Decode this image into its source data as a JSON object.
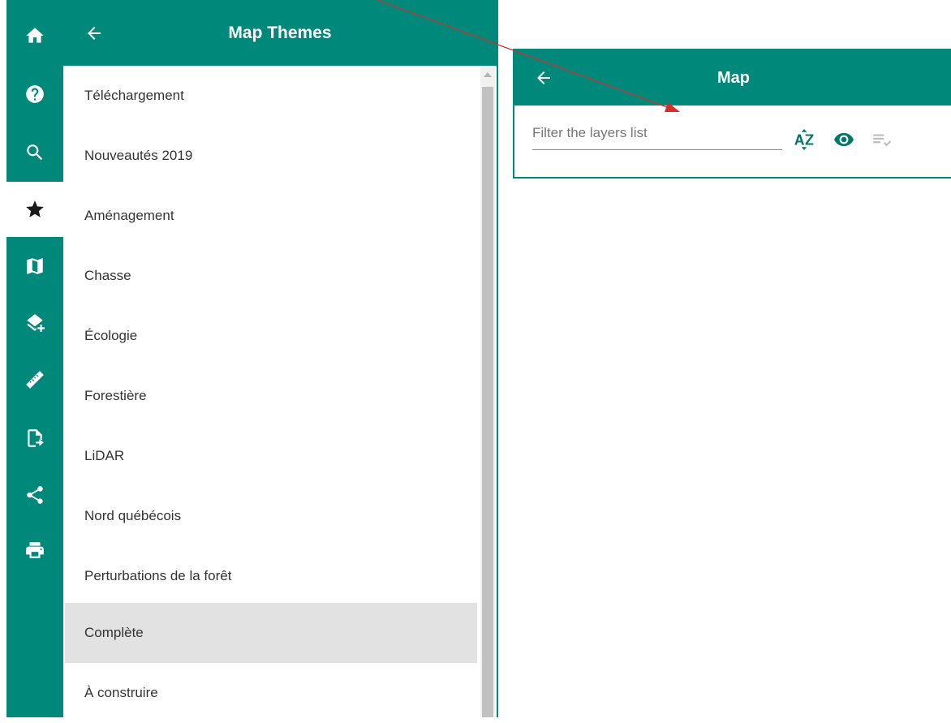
{
  "colors": {
    "accent": "#00897b",
    "annotation": "#d32f2f"
  },
  "rail": {
    "items": [
      {
        "icon": "home-icon"
      },
      {
        "icon": "help-icon"
      },
      {
        "icon": "search-icon"
      },
      {
        "icon": "star-icon",
        "active": true
      },
      {
        "icon": "map-icon"
      },
      {
        "icon": "add-layer-icon"
      },
      {
        "icon": "ruler-icon"
      },
      {
        "icon": "export-file-icon"
      },
      {
        "icon": "share-icon"
      },
      {
        "icon": "print-icon"
      }
    ]
  },
  "themes_panel": {
    "title": "Map Themes",
    "back_icon": "arrow-left-icon",
    "items": [
      {
        "label": "Téléchargement"
      },
      {
        "label": "Nouveautés 2019"
      },
      {
        "label": "Aménagement"
      },
      {
        "label": "Chasse"
      },
      {
        "label": "Écologie"
      },
      {
        "label": "Forestière"
      },
      {
        "label": "LiDAR"
      },
      {
        "label": "Nord québécois"
      },
      {
        "label": "Perturbations de la forêt"
      },
      {
        "label": "Complète",
        "selected": true
      },
      {
        "label": "À construire"
      }
    ]
  },
  "map_panel": {
    "title": "Map",
    "back_icon": "arrow-left-icon",
    "filter": {
      "placeholder": "Filter the layers list",
      "value": ""
    },
    "tools": [
      {
        "icon": "sort-alpha-icon"
      },
      {
        "icon": "eye-icon"
      },
      {
        "icon": "checklist-icon",
        "disabled": true
      }
    ]
  }
}
